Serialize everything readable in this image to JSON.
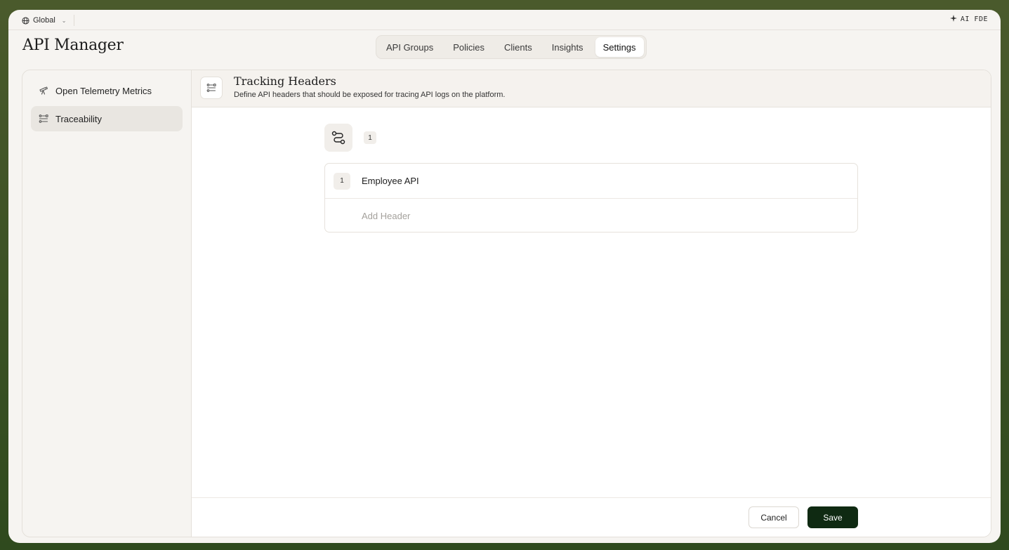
{
  "topbar": {
    "scope_label": "Global",
    "scope_icon": "globe-icon",
    "ai_label": "AI FDE",
    "ai_icon": "sparkle-icon"
  },
  "app": {
    "title": "API Manager"
  },
  "tabs": [
    {
      "label": "API Groups",
      "active": false
    },
    {
      "label": "Policies",
      "active": false
    },
    {
      "label": "Clients",
      "active": false
    },
    {
      "label": "Insights",
      "active": false
    },
    {
      "label": "Settings",
      "active": true
    }
  ],
  "sidebar": {
    "items": [
      {
        "label": "Open Telemetry Metrics",
        "icon": "telescope-icon",
        "active": false
      },
      {
        "label": "Traceability",
        "icon": "traceability-icon",
        "active": true
      }
    ]
  },
  "section": {
    "icon": "traceability-icon",
    "title": "Tracking Headers",
    "description": "Define API headers that should be exposed for tracing API logs on the platform."
  },
  "headers": {
    "icon": "route-icon",
    "count": "1",
    "rows": [
      {
        "index": "1",
        "label": "Employee API"
      }
    ],
    "add_placeholder": "Add Header"
  },
  "footer": {
    "cancel_label": "Cancel",
    "save_label": "Save"
  },
  "colors": {
    "primary_button": "#0f2a12",
    "background_outer": "#3b5224",
    "surface": "#f6f4f1"
  }
}
